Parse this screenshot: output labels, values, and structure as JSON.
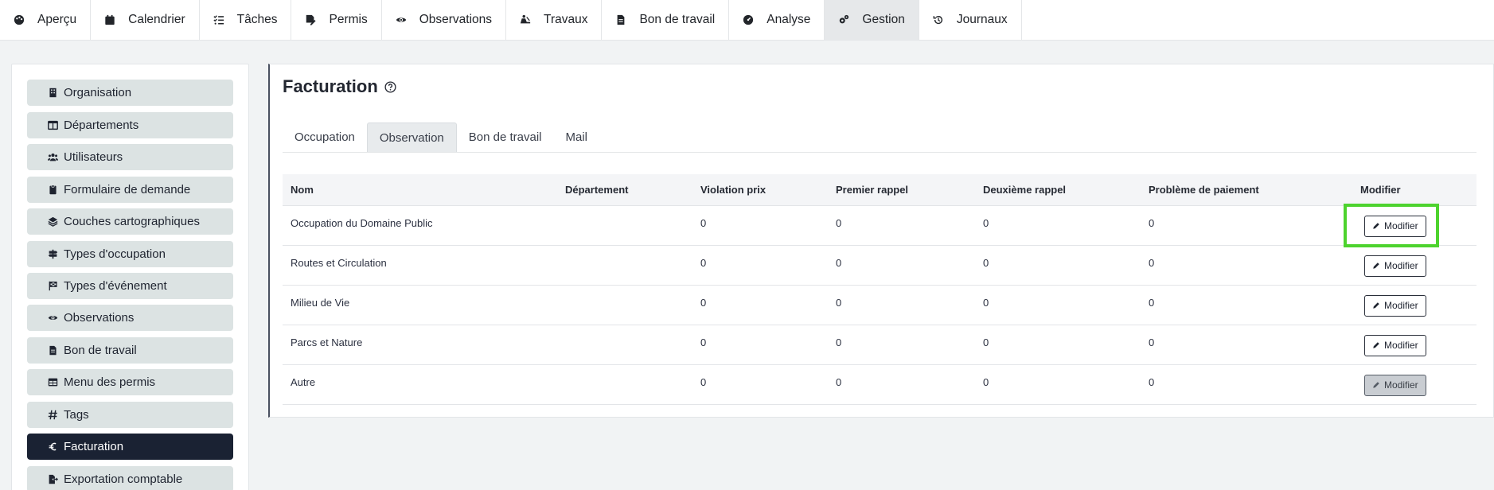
{
  "topnav": {
    "items": [
      {
        "label": "Aperçu",
        "icon": "palette-icon"
      },
      {
        "label": "Calendrier",
        "icon": "calendar-icon"
      },
      {
        "label": "Tâches",
        "icon": "tasks-icon"
      },
      {
        "label": "Permis",
        "icon": "signature-icon"
      },
      {
        "label": "Observations",
        "icon": "eye-icon"
      },
      {
        "label": "Travaux",
        "icon": "digging-icon"
      },
      {
        "label": "Bon de travail",
        "icon": "file-icon"
      },
      {
        "label": "Analyse",
        "icon": "gauge-icon"
      },
      {
        "label": "Gestion",
        "icon": "cogs-icon"
      },
      {
        "label": "Journaux",
        "icon": "history-icon"
      }
    ],
    "active": "Gestion"
  },
  "sidebar": {
    "items": [
      {
        "label": "Organisation",
        "icon": "building-icon"
      },
      {
        "label": "Départements",
        "icon": "columns-icon"
      },
      {
        "label": "Utilisateurs",
        "icon": "users-icon"
      },
      {
        "label": "Formulaire de demande",
        "icon": "clipboard-icon"
      },
      {
        "label": "Couches cartographiques",
        "icon": "layers-icon"
      },
      {
        "label": "Types d'occupation",
        "icon": "signs-icon"
      },
      {
        "label": "Types d'événement",
        "icon": "flag-icon"
      },
      {
        "label": "Observations",
        "icon": "eye-icon"
      },
      {
        "label": "Bon de travail",
        "icon": "file-icon"
      },
      {
        "label": "Menu des permis",
        "icon": "table-icon"
      },
      {
        "label": "Tags",
        "icon": "hashtag-icon"
      },
      {
        "label": "Facturation",
        "icon": "euro-icon"
      },
      {
        "label": "Exportation comptable",
        "icon": "file-export-icon"
      }
    ],
    "active": "Facturation"
  },
  "main": {
    "title": "Facturation",
    "tabs": [
      "Occupation",
      "Observation",
      "Bon de travail",
      "Mail"
    ],
    "active_tab": "Observation",
    "table": {
      "headers": [
        "Nom",
        "Département",
        "Violation prix",
        "Premier rappel",
        "Deuxième rappel",
        "Problème de paiement",
        "Modifier"
      ],
      "rows": [
        {
          "nom": "Occupation du Domaine Public",
          "departement": "",
          "violation": "0",
          "premier": "0",
          "deuxieme": "0",
          "probleme": "0"
        },
        {
          "nom": "Routes et Circulation",
          "departement": "",
          "violation": "0",
          "premier": "0",
          "deuxieme": "0",
          "probleme": "0"
        },
        {
          "nom": "Milieu de Vie",
          "departement": "",
          "violation": "0",
          "premier": "0",
          "deuxieme": "0",
          "probleme": "0"
        },
        {
          "nom": "Parcs et Nature",
          "departement": "",
          "violation": "0",
          "premier": "0",
          "deuxieme": "0",
          "probleme": "0"
        },
        {
          "nom": "Autre",
          "departement": "",
          "violation": "0",
          "premier": "0",
          "deuxieme": "0",
          "probleme": "0"
        }
      ],
      "button_label": "Modifier"
    }
  },
  "colors": {
    "active_sidebar": "#1a2233",
    "highlight": "#4dd32e"
  }
}
